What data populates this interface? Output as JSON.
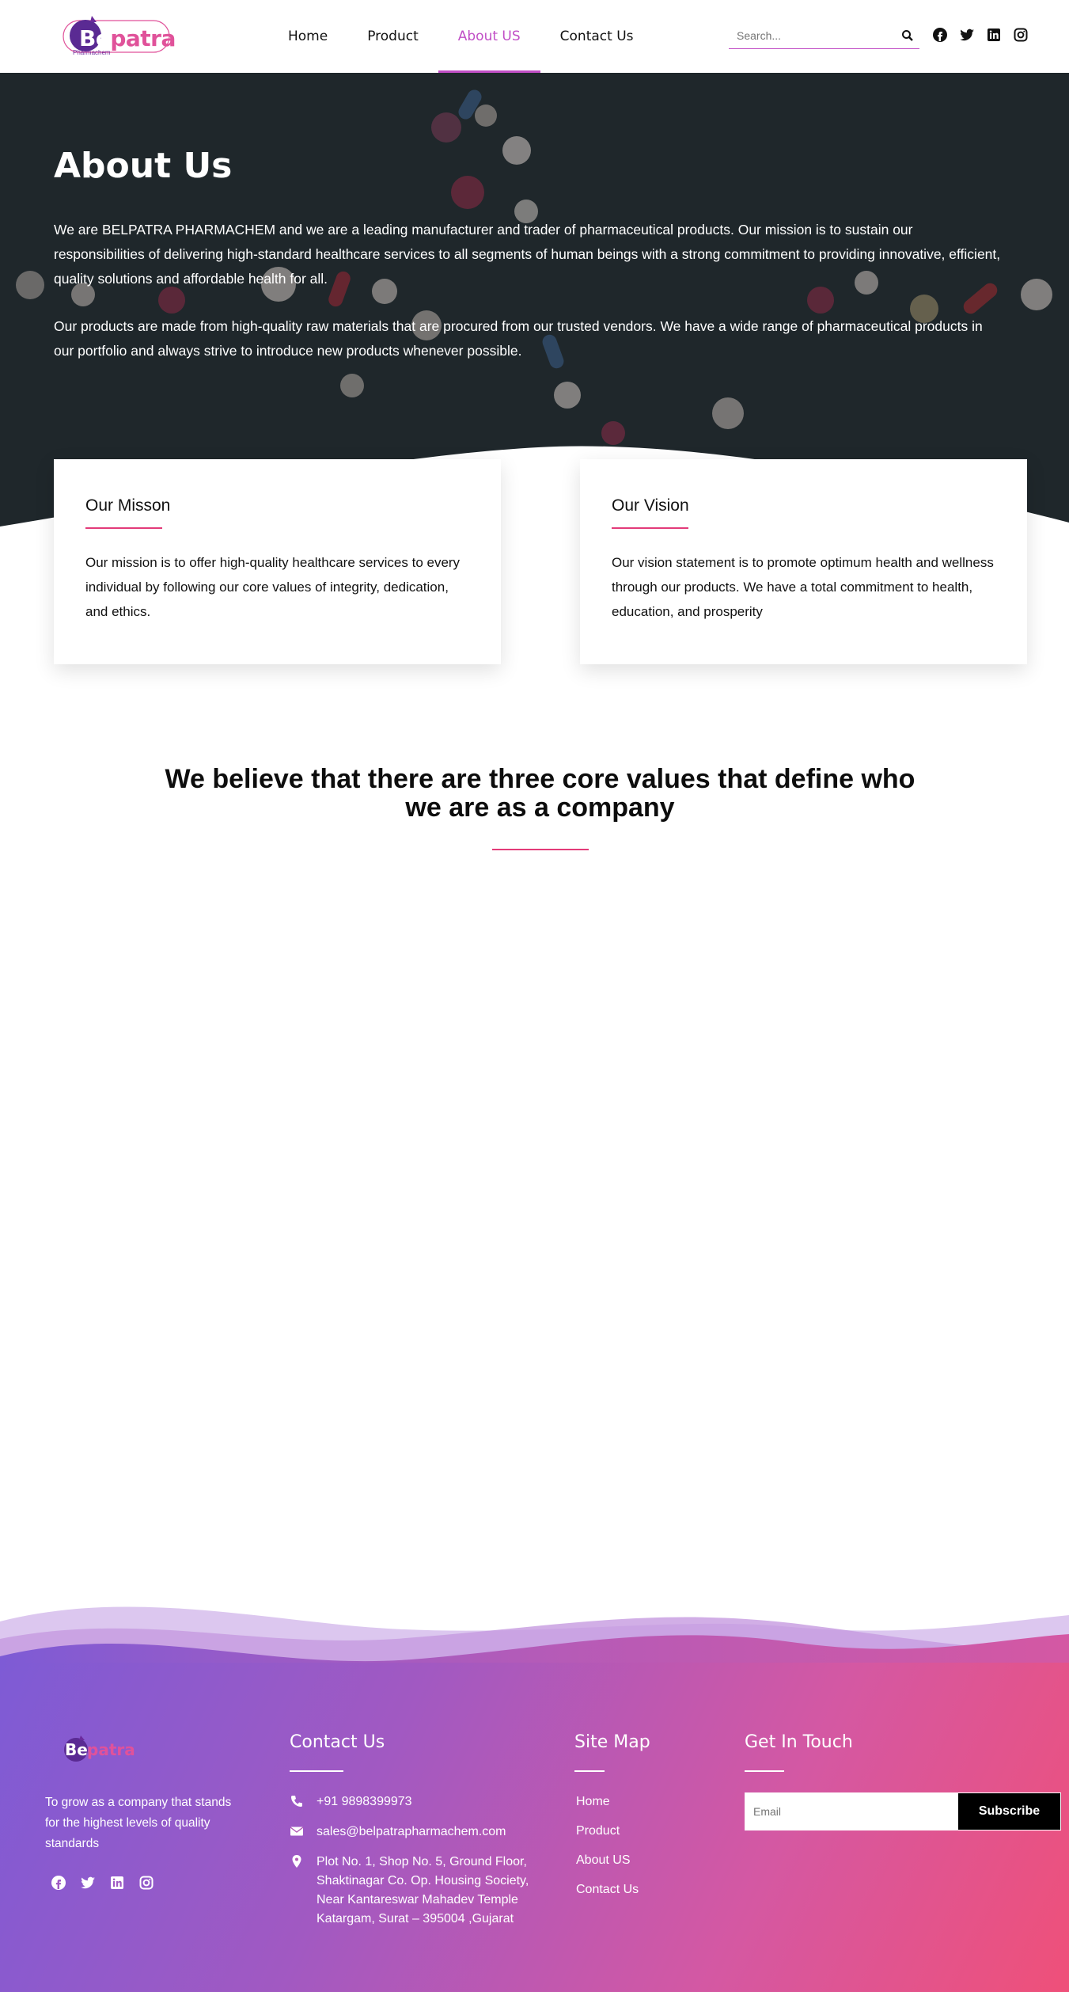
{
  "brand": {
    "logo_main": "patra",
    "logo_prefix": "Be",
    "logo_sub": "Pharmachem",
    "accent": "#c14fc6",
    "pink": "#e33b79"
  },
  "nav": {
    "items": [
      {
        "label": "Home",
        "active": false
      },
      {
        "label": "Product",
        "active": false
      },
      {
        "label": "About US",
        "active": true
      },
      {
        "label": "Contact Us",
        "active": false
      }
    ],
    "search_placeholder": "Search...",
    "social_icons": [
      "facebook-icon",
      "twitter-icon",
      "linkedin-icon",
      "instagram-icon"
    ]
  },
  "hero": {
    "title": "About Us",
    "paragraph_1": "We are BELPATRA PHARMACHEM and we are a leading manufacturer and trader of pharmaceutical products. Our mission is to sustain our responsibilities of delivering high-standard healthcare services to all segments of human beings with a strong commitment to providing innovative, efficient, quality solutions and affordable health for all.",
    "paragraph_2": "Our products are made from high-quality raw materials that are procured from our trusted vendors. We have a wide range of pharmaceutical products in our portfolio and always strive to introduce new products whenever possible."
  },
  "cards": {
    "mission": {
      "title": "Our Misson",
      "text": "Our mission is to offer high-quality healthcare services to every individual by following our core values of integrity, dedication, and ethics."
    },
    "vision": {
      "title": "Our Vision",
      "text": "Our vision statement is to promote optimum health and wellness through our products. We have a total commitment to health, education, and prosperity"
    }
  },
  "values": {
    "title": "We believe that there are three core values that define who we are as a company"
  },
  "footer": {
    "about": "To grow as a company that stands for the highest levels of quality standards",
    "contact_heading": "Contact Us",
    "phone": "+91 9898399973",
    "email": "sales@belpatrapharmachem.com",
    "address": "Plot No. 1, Shop No. 5, Ground Floor, Shaktinagar Co. Op. Housing Society, Near Kantareswar Mahadev Temple Katargam, Surat – 395004 ,Gujarat",
    "sitemap_heading": "Site Map",
    "sitemap": [
      "Home",
      "Product",
      "About US",
      "Contact Us"
    ],
    "touch_heading": "Get In Touch",
    "email_placeholder": "Email",
    "subscribe_label": "Subscribe"
  }
}
